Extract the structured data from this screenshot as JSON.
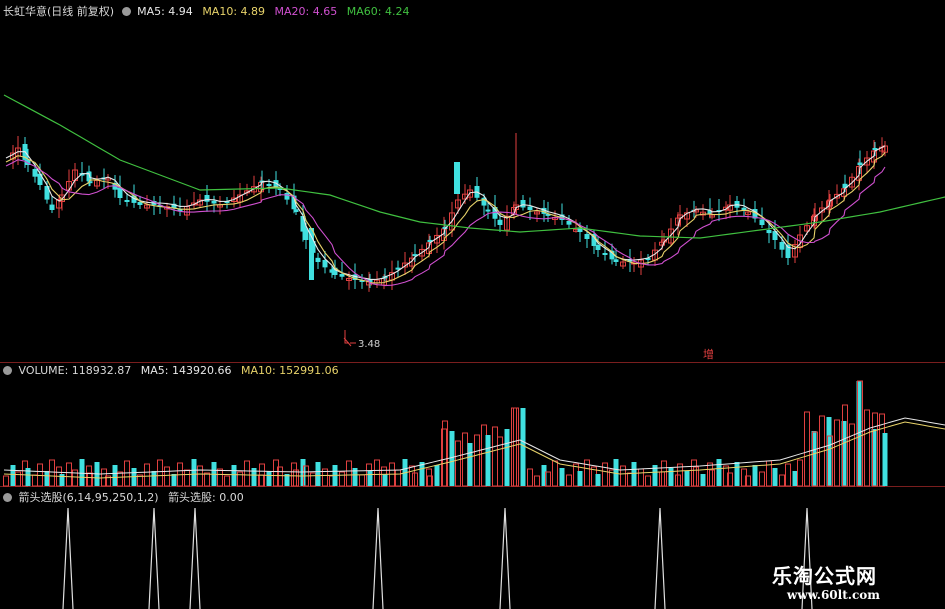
{
  "price_panel": {
    "title": "长虹华意(日线 前复权)",
    "ma5": {
      "label": "MA5: 4.94",
      "color": "#e8e8e8"
    },
    "ma10": {
      "label": "MA10: 4.89",
      "color": "#e8d36a"
    },
    "ma20": {
      "label": "MA20: 4.65",
      "color": "#d050d0"
    },
    "ma60": {
      "label": "MA60: 4.24",
      "color": "#40c040"
    },
    "low_marker": "3.48",
    "zeng_label": "增"
  },
  "volume_panel": {
    "label": "VOLUME: 118932.87",
    "ma5": {
      "label": "MA5: 143920.66",
      "color": "#e8e8e8"
    },
    "ma10": {
      "label": "MA10: 152991.06",
      "color": "#e8d36a"
    }
  },
  "indicator_panel": {
    "label": "箭头选股(6,14,95,250,1,2)",
    "value": "箭头选股: 0.00"
  },
  "colors": {
    "up": "#e04040",
    "down": "#40e0e0",
    "panel_sep": "#7a1e1e",
    "indicator": "#e0e0e0"
  },
  "watermark": {
    "name": "乐淘公式网",
    "url": "www.60lt.com"
  }
}
